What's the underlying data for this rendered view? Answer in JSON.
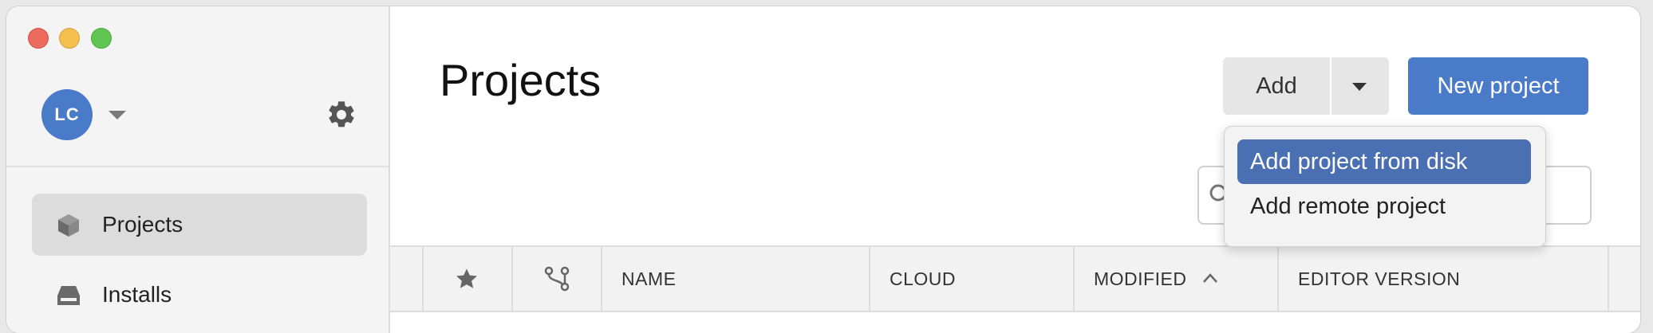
{
  "window": {
    "traffic_lights": [
      "close",
      "minimize",
      "zoom"
    ]
  },
  "sidebar": {
    "user_initials": "LC",
    "items": [
      {
        "label": "Projects",
        "icon": "cube-icon",
        "active": true
      },
      {
        "label": "Installs",
        "icon": "drive-icon",
        "active": false
      }
    ]
  },
  "main": {
    "title": "Projects",
    "add_label": "Add",
    "new_project_label": "New project",
    "dropdown": [
      {
        "label": "Add project from disk",
        "selected": true
      },
      {
        "label": "Add remote project",
        "selected": false
      }
    ],
    "columns": [
      "NAME",
      "CLOUD",
      "MODIFIED",
      "EDITOR VERSION"
    ],
    "sorted_column": "MODIFIED",
    "sort_direction": "ascending"
  },
  "colors": {
    "accent": "#4a7bc8",
    "menu_highlight": "#4a6fb2"
  }
}
